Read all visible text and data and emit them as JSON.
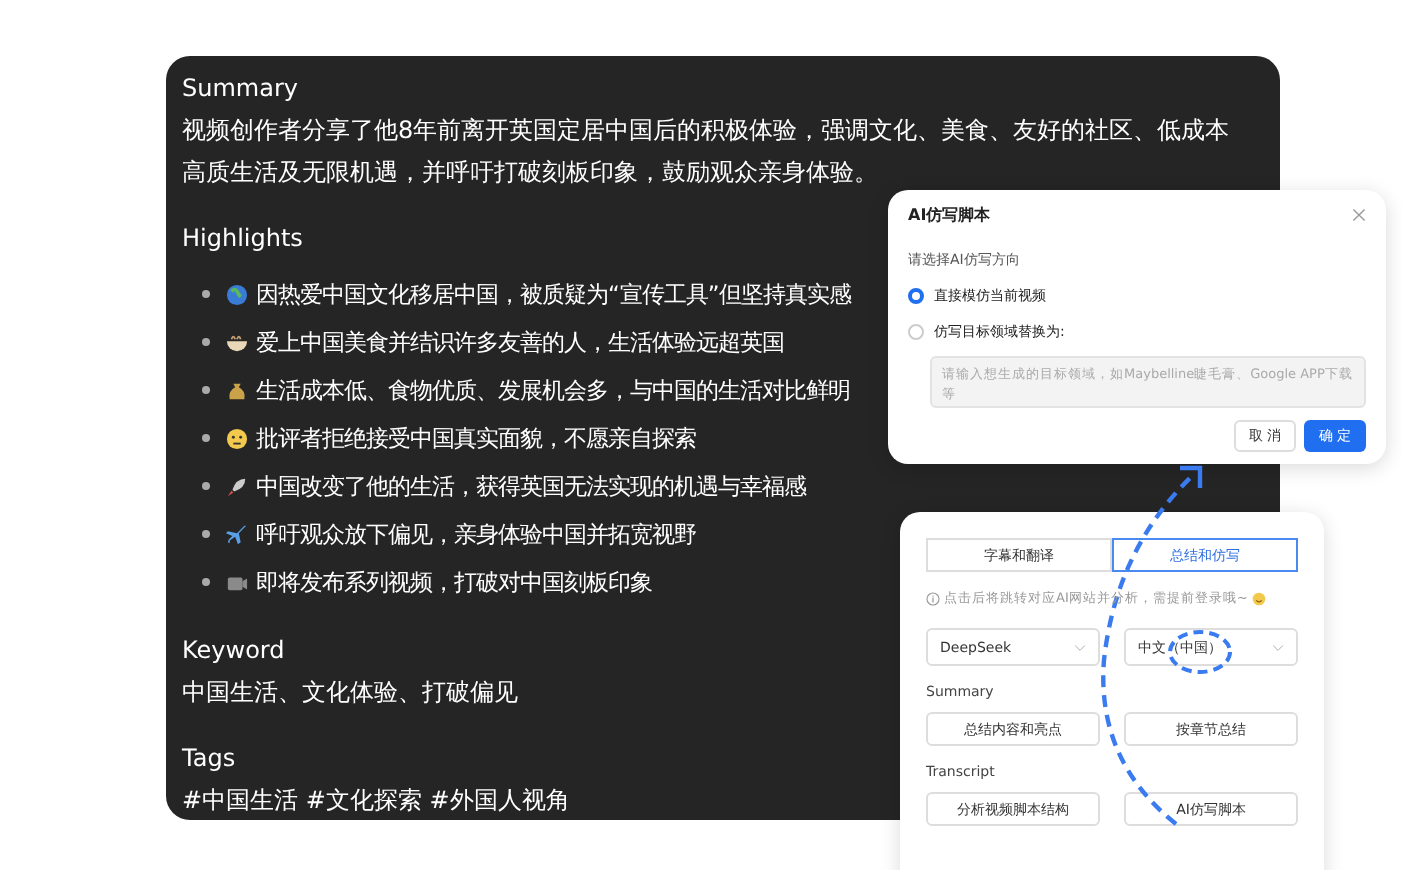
{
  "summary_card": {
    "summary": {
      "heading": "Summary",
      "text": "视频创作者分享了他8年前离开英国定居中国后的积极体验，强调文化、美食、友好的社区、低成本高质生活及无限机遇，并呼吁打破刻板印象，鼓励观众亲身体验。"
    },
    "highlights": {
      "heading": "Highlights",
      "items": [
        {
          "text": "因热爱中国文化移居中国，被质疑为“宣传工具”但坚持真实感"
        },
        {
          "text": "爱上中国美食并结识许多友善的人，生活体验远超英国"
        },
        {
          "text": "生活成本低、食物优质、发展机会多，与中国的生活对比鲜明"
        },
        {
          "text": "批评者拒绝接受中国真实面貌，不愿亲自探索"
        },
        {
          "text": "中国改变了他的生活，获得英国无法实现的机遇与幸福感"
        },
        {
          "text": "呼吁观众放下偏见，亲身体验中国并拓宽视野"
        },
        {
          "text": "即将发布系列视频，打破对中国刻板印象"
        }
      ]
    },
    "keyword": {
      "heading": "Keyword",
      "text": "中国生活、文化体验、打破偏见"
    },
    "tags": {
      "heading": "Tags",
      "text": "#中国生活 #文化探索 #外国人视角"
    }
  },
  "dialog": {
    "title": "AI仿写脚本",
    "prompt": "请选择AI仿写方向",
    "options": [
      {
        "label": "直接模仿当前视频",
        "selected": true
      },
      {
        "label": "仿写目标领域替换为:",
        "selected": false
      }
    ],
    "textarea": {
      "placeholder": "请输入想生成的目标领域，如Maybelline睫毛膏、Google APP下载等"
    },
    "buttons": [
      {
        "label": "取 消",
        "kind": "secondary"
      },
      {
        "label": "确 定",
        "kind": "primary"
      }
    ]
  },
  "panel": {
    "tabs": [
      {
        "label": "字幕和翻译",
        "selected": false
      },
      {
        "label": "总结和仿写",
        "selected": true
      }
    ],
    "hint": "点击后将跳转对应AI网站并分析，需提前登录哦~",
    "selects": [
      {
        "value": "DeepSeek"
      },
      {
        "value": "中文（中国）"
      }
    ],
    "sections": [
      {
        "heading": "Summary",
        "buttons": [
          "总结内容和亮点",
          "按章节总结"
        ]
      },
      {
        "heading": "Transcript",
        "buttons": [
          "分析视频脚本结构",
          "AI仿写脚本"
        ]
      }
    ]
  }
}
